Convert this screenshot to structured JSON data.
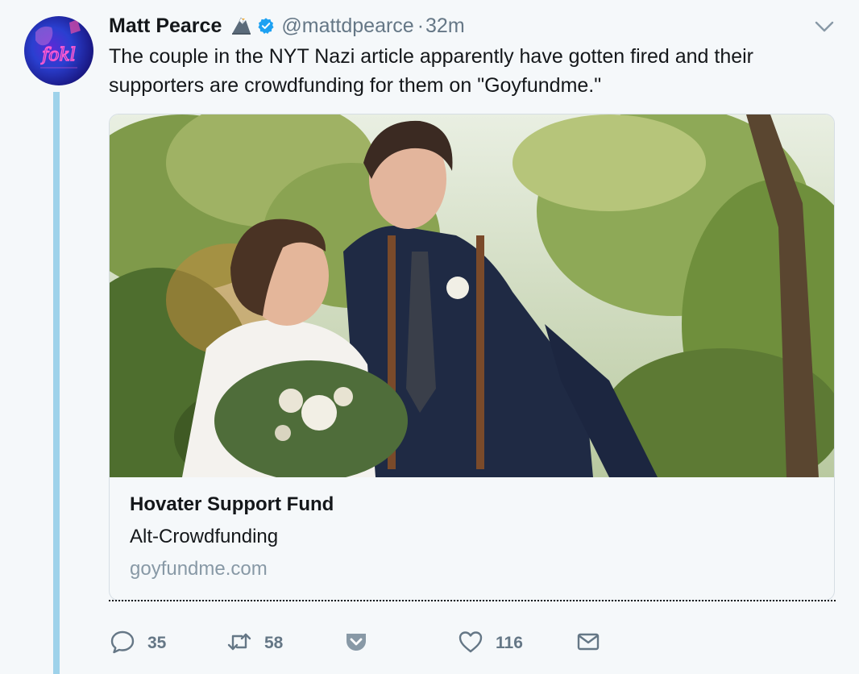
{
  "tweet": {
    "author_name": "Matt Pearce",
    "handle": "@mattdpearce",
    "separator": "·",
    "timestamp": "32m",
    "text": "The couple in the NYT Nazi article apparently have gotten fired and their supporters are crowdfunding for them on \"Goyfundme.\"",
    "avatar_text": "fokl"
  },
  "card": {
    "title": "Hovater Support Fund",
    "description": "Alt-Crowdfunding",
    "domain": "goyfundme.com"
  },
  "actions": {
    "replies": "35",
    "retweets": "58",
    "likes": "116"
  },
  "icons": {
    "verified": "verified-badge-icon",
    "emoji": "eagle-emoji-icon",
    "more": "chevron-down-icon",
    "reply": "reply-icon",
    "retweet": "retweet-icon",
    "pocket": "pocket-icon",
    "like": "heart-icon",
    "dm": "envelope-icon"
  },
  "colors": {
    "background": "#f5f8fa",
    "thread_line": "#9ed2ea",
    "verified": "#1da1f2",
    "muted": "#657786",
    "pocket": "#8899a6"
  }
}
